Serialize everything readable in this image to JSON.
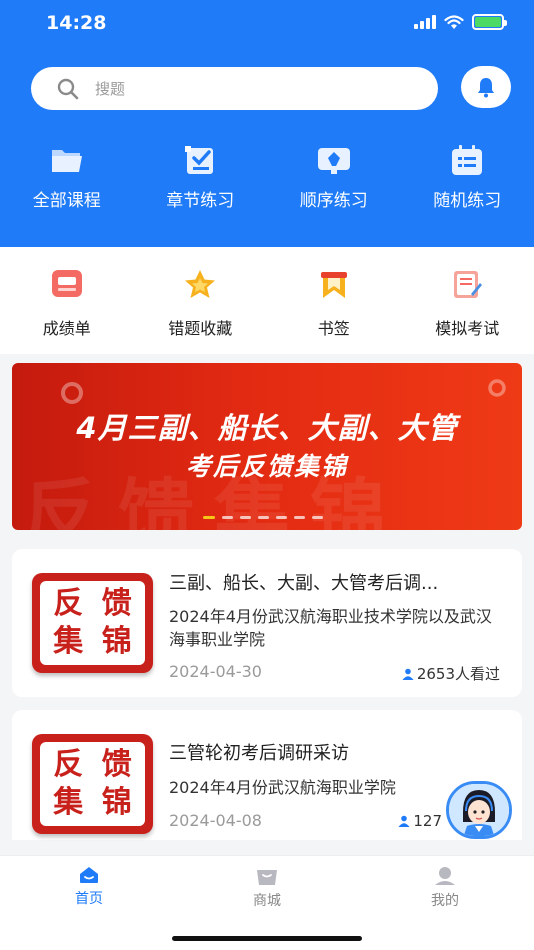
{
  "status_bar": {
    "time": "14:28"
  },
  "search": {
    "placeholder": "搜题"
  },
  "top_nav": [
    {
      "label": "全部课程",
      "icon": "folder-icon"
    },
    {
      "label": "章节练习",
      "icon": "checklist-icon"
    },
    {
      "label": "顺序练习",
      "icon": "pen-icon"
    },
    {
      "label": "随机练习",
      "icon": "calendar-list-icon"
    }
  ],
  "tools": [
    {
      "label": "成绩单",
      "icon": "report-card-icon"
    },
    {
      "label": "错题收藏",
      "icon": "star-icon"
    },
    {
      "label": "书签",
      "icon": "bookmark-icon"
    },
    {
      "label": "模拟考试",
      "icon": "exam-paper-icon"
    }
  ],
  "banner": {
    "line1": "4月三副、船长、大副、大管",
    "line2": "考后反馈集锦",
    "background_text": "反馈集锦",
    "slide_count": 7,
    "active_slide": 1
  },
  "articles": [
    {
      "thumb_text": [
        "反",
        "馈",
        "集",
        "锦"
      ],
      "title": "三副、船长、大副、大管考后调...",
      "description": "2024年4月份武汉航海职业技术学院以及武汉海事职业学院",
      "date": "2024-04-30",
      "views": "2653人看过"
    },
    {
      "thumb_text": [
        "反",
        "馈",
        "集",
        "锦"
      ],
      "title": "三管轮初考后调研采访",
      "description": "2024年4月份武汉航海职业学院",
      "date": "2024-04-08",
      "views": "127"
    }
  ],
  "tabbar": [
    {
      "label": "首页",
      "icon": "home-icon",
      "active": true
    },
    {
      "label": "商城",
      "icon": "shop-bag-icon",
      "active": false
    },
    {
      "label": "我的",
      "icon": "profile-icon",
      "active": false
    }
  ],
  "colors": {
    "primary": "#1f7bf7",
    "banner_red": "#e22a12",
    "thumb_red": "#c8201a"
  }
}
